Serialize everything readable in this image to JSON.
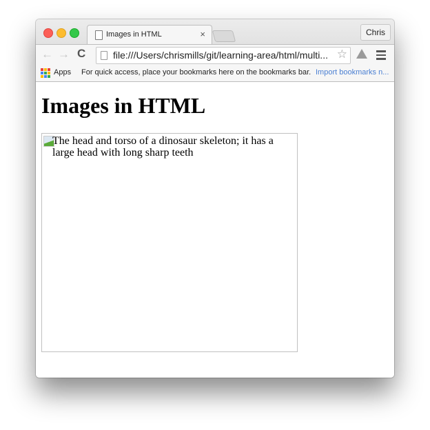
{
  "window": {
    "tab": {
      "title": "Images in HTML",
      "icon": "document-icon",
      "close_glyph": "×"
    },
    "profile_label": "Chris",
    "toolbar": {
      "back_glyph": "←",
      "forward_glyph": "→",
      "reload_glyph": "C",
      "url": "file:///Users/chrismills/git/learning-area/html/multi...",
      "star_glyph": "☆"
    },
    "bookmarks_bar": {
      "apps_label": "Apps",
      "hint": "For quick access, place your bookmarks here on the bookmarks bar.",
      "import_label": "Import bookmarks n...",
      "import_color": "#4a7fd2",
      "apps_colors": [
        "#e94235",
        "#fbbc05",
        "#e94235",
        "#4285f4",
        "#34a853",
        "#fbbc05",
        "#fbbc05",
        "#4285f4",
        "#34a853"
      ]
    }
  },
  "page": {
    "heading": "Images in HTML",
    "image_alt": "The head and torso of a dinosaur skeleton; it has a large head with long sharp teeth"
  }
}
